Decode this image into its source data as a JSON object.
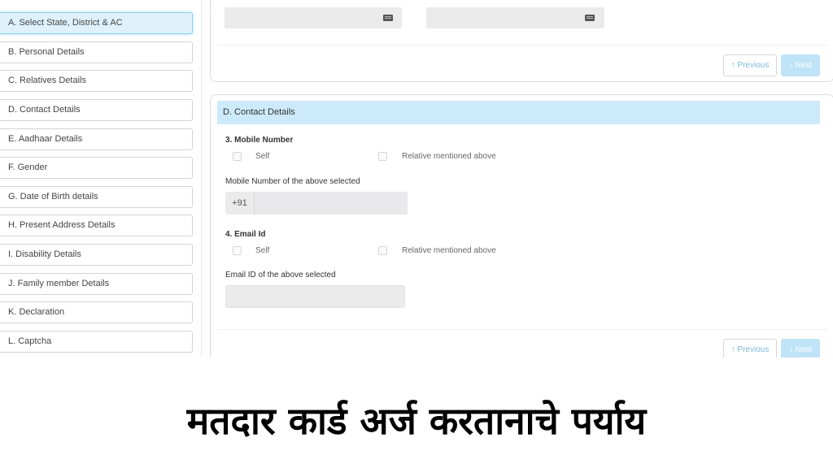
{
  "sidebar": {
    "items": [
      {
        "label": "A. Select State, District & AC",
        "active": true
      },
      {
        "label": "B. Personal Details",
        "active": false
      },
      {
        "label": "C. Relatives Details",
        "active": false
      },
      {
        "label": "D. Contact Details",
        "active": false
      },
      {
        "label": "E. Aadhaar Details",
        "active": false
      },
      {
        "label": "F. Gender",
        "active": false
      },
      {
        "label": "G. Date of Birth details",
        "active": false
      },
      {
        "label": "H. Present Address Details",
        "active": false
      },
      {
        "label": "I. Disability Details",
        "active": false
      },
      {
        "label": "J. Family member Details",
        "active": false
      },
      {
        "label": "K. Declaration",
        "active": false
      },
      {
        "label": "L. Captcha",
        "active": false
      }
    ]
  },
  "top_card": {
    "fields": [
      {
        "value": "",
        "icon": "keyboard-icon"
      },
      {
        "value": "",
        "icon": "keyboard-icon"
      }
    ],
    "previous_label": "↑ Previous",
    "next_label": "↓ Next"
  },
  "contact_section": {
    "header": "D. Contact Details",
    "mobile": {
      "question": "3. Mobile Number",
      "options": [
        "Self",
        "Relative mentioned above"
      ],
      "field_label": "Mobile Number of the above selected",
      "prefix": "+91",
      "value": ""
    },
    "email": {
      "question": "4. Email Id",
      "options": [
        "Self",
        "Relative mentioned above"
      ],
      "field_label": "Email ID of the above selected",
      "value": ""
    },
    "previous_label": "↑ Previous",
    "next_label": "↓ Next"
  },
  "banner": {
    "title": "मतदार कार्ड अर्ज करतानाचे पर्याय"
  },
  "colors": {
    "active_item_bg": "#dff2fb",
    "section_header_bg": "#cdeafb",
    "next_button_bg": "#bfe4f7",
    "previous_text": "#7fb8d8"
  }
}
